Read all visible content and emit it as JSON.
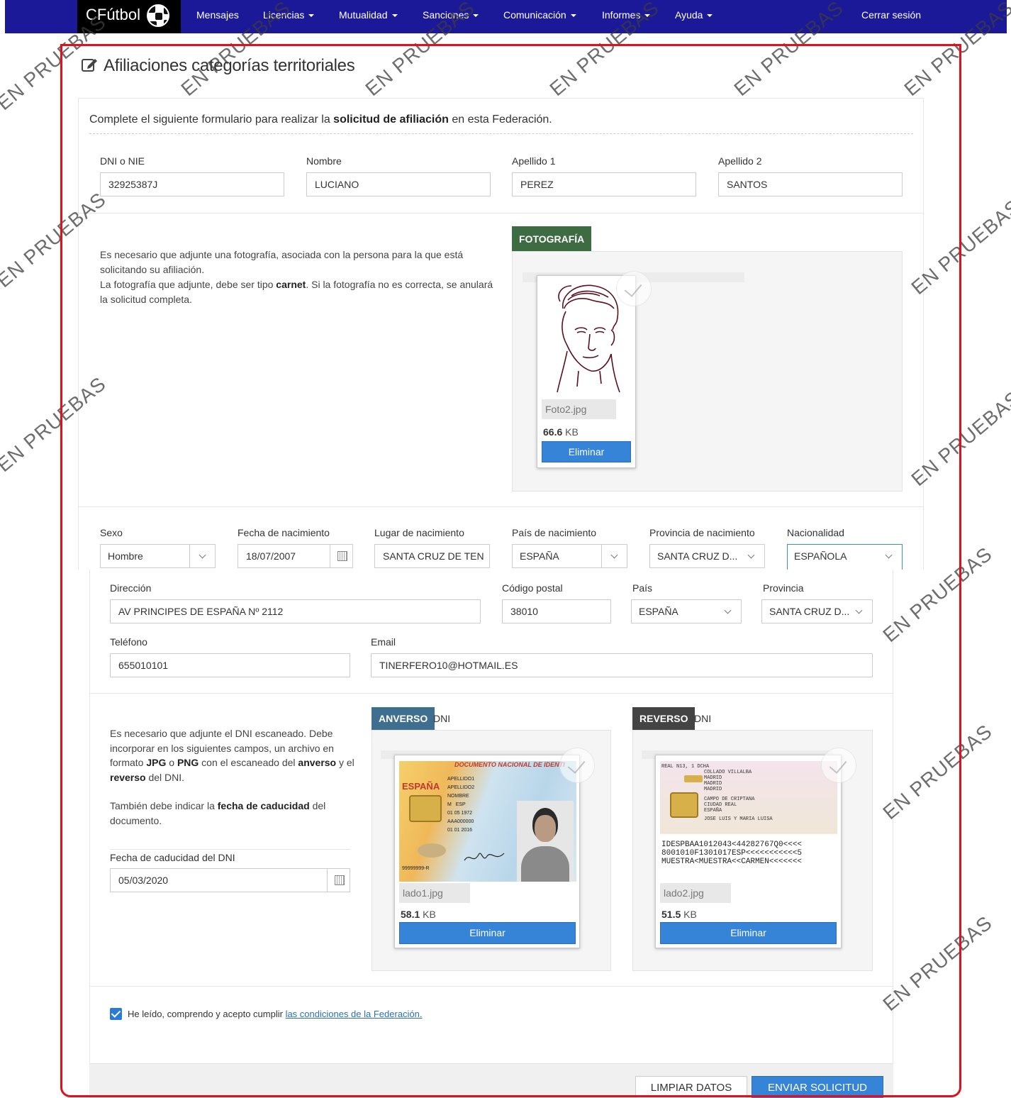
{
  "navbar": {
    "brand": "CFútbol",
    "items": [
      "Mensajes",
      "Licencias",
      "Mutualidad",
      "Sanciones",
      "Comunicación",
      "Informes",
      "Ayuda"
    ],
    "logout": "Cerrar sesión",
    "bg_color": "#1c1999"
  },
  "page": {
    "title": "Afiliaciones categorías territoriales",
    "intro_before": "Complete el siguiente formulario para realizar la ",
    "intro_bold": "solicitud de afiliación",
    "intro_after": " en esta Federación."
  },
  "identity": {
    "dni_label": "DNI o NIE",
    "dni_value": "32925387J",
    "nombre_label": "Nombre",
    "nombre_value": "LUCIANO",
    "apellido1_label": "Apellido 1",
    "apellido1_value": "PEREZ",
    "apellido2_label": "Apellido 2",
    "apellido2_value": "SANTOS"
  },
  "photo": {
    "text1": "Es necesario que adjunte una fotografía, asociada con la persona para la que está solicitando su afiliación.",
    "text2_before": "La fotografía que adjunte, debe ser tipo ",
    "text2_bold": "carnet",
    "text2_after": ". Si la fotografía no es correcta, se anulará la solicitud completa.",
    "tag": "FOTOGRAFÍA",
    "tag_color": "#3d6b42",
    "file_name": "Foto2.jpg",
    "file_size_num": "66.6",
    "file_size_unit": " KB",
    "remove_label": "Eliminar"
  },
  "birth": {
    "sexo_label": "Sexo",
    "sexo_value": "Hombre",
    "fecha_label": "Fecha de nacimiento",
    "fecha_value": "18/07/2007",
    "lugar_label": "Lugar de nacimiento",
    "lugar_value": "SANTA CRUZ DE TEN",
    "pais_label": "País de nacimiento",
    "pais_value": "ESPAÑA",
    "provincia_label": "Provincia de nacimiento",
    "provincia_value": "SANTA CRUZ D...",
    "nacionalidad_label": "Nacionalidad",
    "nacionalidad_value": "ESPAÑOLA"
  },
  "address": {
    "direccion_label": "Dirección",
    "direccion_value": "AV PRINCIPES DE ESPAÑA Nº 2112",
    "cp_label": "Código postal",
    "cp_value": "38010",
    "pais_label": "País",
    "pais_value": "ESPAÑA",
    "provincia_label": "Provincia",
    "provincia_value": "SANTA CRUZ D...",
    "telefono_label": "Teléfono",
    "telefono_value": "655010101",
    "email_label": "Email",
    "email_value": "TINERFERO10@HOTMAIL.ES"
  },
  "dni_docs": {
    "text1_a": "Es necesario que adjunte el DNI escaneado. Debe incorporar en los siguientes campos, un archivo en formato ",
    "text1_jpg": "JPG",
    "text1_o": " o ",
    "text1_png": "PNG",
    "text1_b": " con el escaneado del ",
    "text1_anverso": "anverso",
    "text1_c": " y el ",
    "text1_reverso": "reverso",
    "text1_d": " del DNI.",
    "text2_a": "También debe indicar la ",
    "text2_bold": "fecha de caducidad",
    "text2_b": " del documento.",
    "caducidad_label": "Fecha de caducidad del DNI",
    "caducidad_value": "05/03/2020",
    "anverso_tag": "ANVERSO",
    "anverso_suffix": "DNI",
    "anverso_tag_color": "#3f6f8f",
    "reverso_tag": "REVERSO",
    "reverso_suffix": "DNI",
    "reverso_tag_color": "#444444",
    "file1_name": "lado1.jpg",
    "file1_size_num": "58.1",
    "file1_size_unit": " KB",
    "file2_name": "lado2.jpg",
    "file2_size_num": "51.5",
    "file2_size_unit": " KB",
    "remove_label": "Eliminar",
    "anverso_card_text": {
      "header": "DOCUMENTO NACIONAL DE IDENTI",
      "country": "ESPAÑA",
      "apellido1": "APELLIDO1",
      "apellido2": "APELLIDO2",
      "nombre": "NOMBRE",
      "sex": "M",
      "nat": "ESP",
      "birth": "01   05   1972",
      "idesp": "AAA000000",
      "valid": "01   01   2016",
      "dni_num": "99999999-R"
    },
    "reverso_card_text": {
      "line1": "REAL N13, 1 DCHA",
      "line2": "COLLADO VILLALBA",
      "line3": "MADRID",
      "line4": "MADRID",
      "line5": "MADRID",
      "line6": "CAMPO DE CRIPTANA",
      "line7": "CIUDAD REAL",
      "line8": "ESPAÑA",
      "line9": "JOSE LUIS Y MARIA LUISA",
      "mrz1": "IDESPBAA1012043<44282767Q0<<<<",
      "mrz2": "8001010F1301017ESP<<<<<<<<<<<5",
      "mrz3": "MUESTRA<MUESTRA<<CARMEN<<<<<<<"
    }
  },
  "terms": {
    "text": "He leído, comprendo y acepto cumplir ",
    "link": "las condiciones de la Federación."
  },
  "actions": {
    "clear": "LIMPIAR DATOS",
    "submit": "ENVIAR SOLICITUD"
  },
  "watermark": "EN PRUEBAS"
}
